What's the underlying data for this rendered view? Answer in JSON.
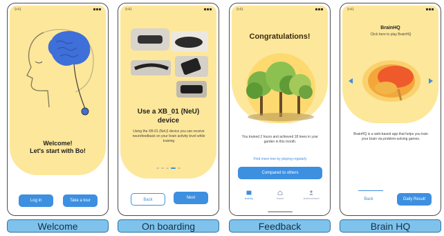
{
  "screens": {
    "welcome": {
      "caption": "Welcome",
      "status_time": "9:41",
      "heading_line1": "Welcome!",
      "heading_line2": "Let's start with Bo!",
      "login_label": "Log in",
      "tour_label": "Take a tour"
    },
    "onboarding": {
      "caption": "On boarding",
      "status_time": "9:41",
      "heading_line1": "Use a XB_01 (NeU)",
      "heading_line2": "device",
      "body_text": "Using the XB-01 (NeU) device you can receive neurofeedback on your brain activity level while training",
      "back_label": "Back",
      "next_label": "Next",
      "page_dots": {
        "count": 5,
        "active_index": 3
      }
    },
    "feedback": {
      "caption": "Feedback",
      "status_time": "9:41",
      "heading": "Congratulations!",
      "body_text": "You trained 2 hours and achieved 18 trees in your garden in this month.",
      "link_text": "Find more tree by playing regularly",
      "compare_label": "Compared to others",
      "tabs": [
        {
          "label": "Activity",
          "icon": "activity-icon",
          "active": true
        },
        {
          "label": "Game",
          "icon": "home-icon",
          "active": false
        },
        {
          "label": "Achievement",
          "icon": "user-icon",
          "active": false
        }
      ]
    },
    "brainhq": {
      "caption": "Brain HQ",
      "status_time": "9:41",
      "heading": "BrainHQ",
      "subheading": "Click here to play BrainHQ",
      "body_text": "BrainHQ is a web-based app that helps you train your brain via problem-solving games.",
      "back_label": "Back",
      "daily_label": "Daily Result"
    }
  },
  "colors": {
    "accent_blue": "#3d8fe0",
    "panel_yellow": "#fde79a",
    "caption_blue": "#7fc3ec",
    "brain_blue": "#3f6fd8"
  }
}
